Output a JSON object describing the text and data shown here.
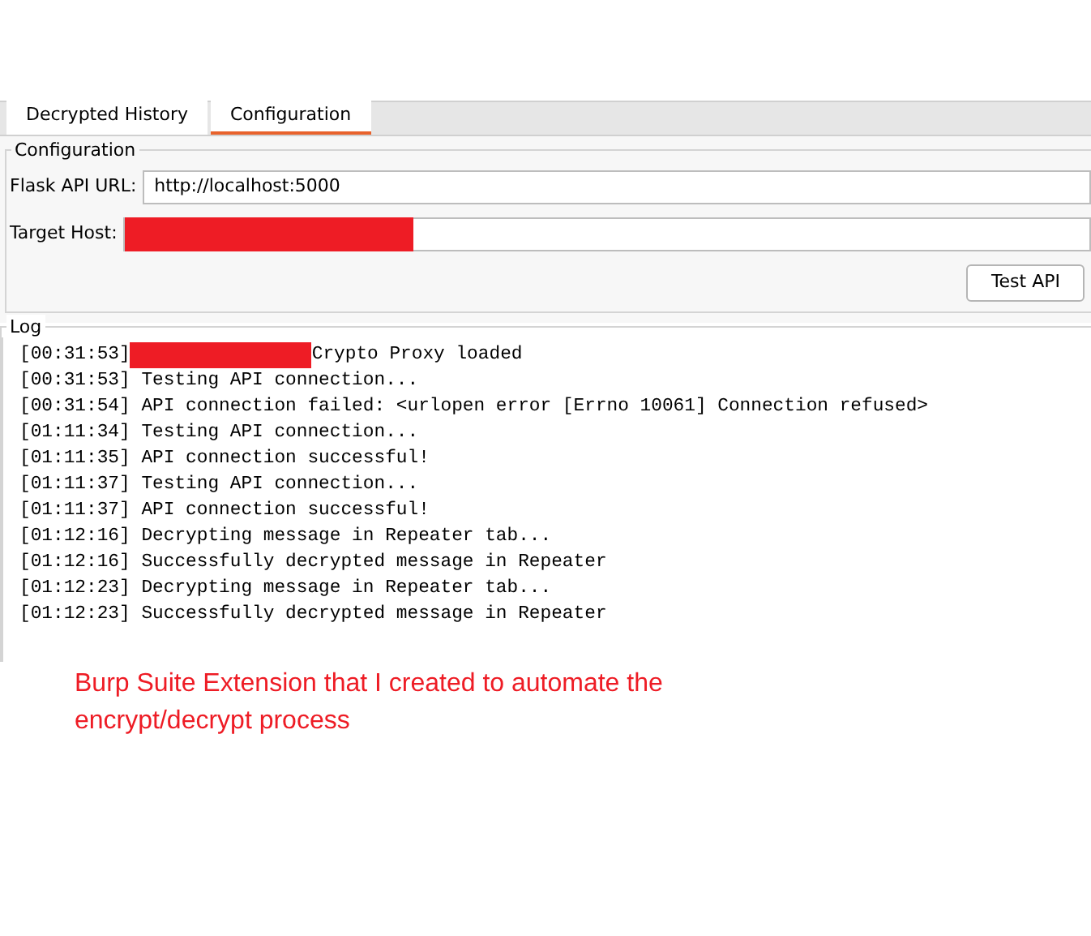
{
  "tabs": [
    {
      "label": "Decrypted History",
      "selected": false
    },
    {
      "label": "Configuration",
      "selected": true
    }
  ],
  "configuration": {
    "title": "Configuration",
    "fields": [
      {
        "label": "Flask API URL:",
        "value": "http://localhost:5000",
        "redacted": false
      },
      {
        "label": "Target Host:",
        "redacted": true
      }
    ],
    "button": "Test API"
  },
  "log": {
    "title": "Log",
    "lines": [
      {
        "time": "[00:31:53]",
        "text": "Crypto Proxy loaded",
        "redacted": true
      },
      {
        "time": "[00:31:53]",
        "text": "Testing API connection...",
        "redacted": false
      },
      {
        "time": "[00:31:54]",
        "text": "API connection failed: <urlopen error [Errno 10061] Connection refused>",
        "redacted": false
      },
      {
        "time": "[01:11:34]",
        "text": "Testing API connection...",
        "redacted": false
      },
      {
        "time": "[01:11:35]",
        "text": "API connection successful!",
        "redacted": false
      },
      {
        "time": "[01:11:37]",
        "text": "Testing API connection...",
        "redacted": false
      },
      {
        "time": "[01:11:37]",
        "text": "API connection successful!",
        "redacted": false
      },
      {
        "time": "[01:12:16]",
        "text": "Decrypting message in Repeater tab...",
        "redacted": false
      },
      {
        "time": "[01:12:16]",
        "text": "Successfully decrypted message in Repeater",
        "redacted": false
      },
      {
        "time": "[01:12:23]",
        "text": "Decrypting message in Repeater tab...",
        "redacted": false
      },
      {
        "time": "[01:12:23]",
        "text": "Successfully decrypted message in Repeater",
        "redacted": false
      }
    ]
  },
  "caption": "Burp Suite Extension that I created to automate the encrypt/decrypt process"
}
